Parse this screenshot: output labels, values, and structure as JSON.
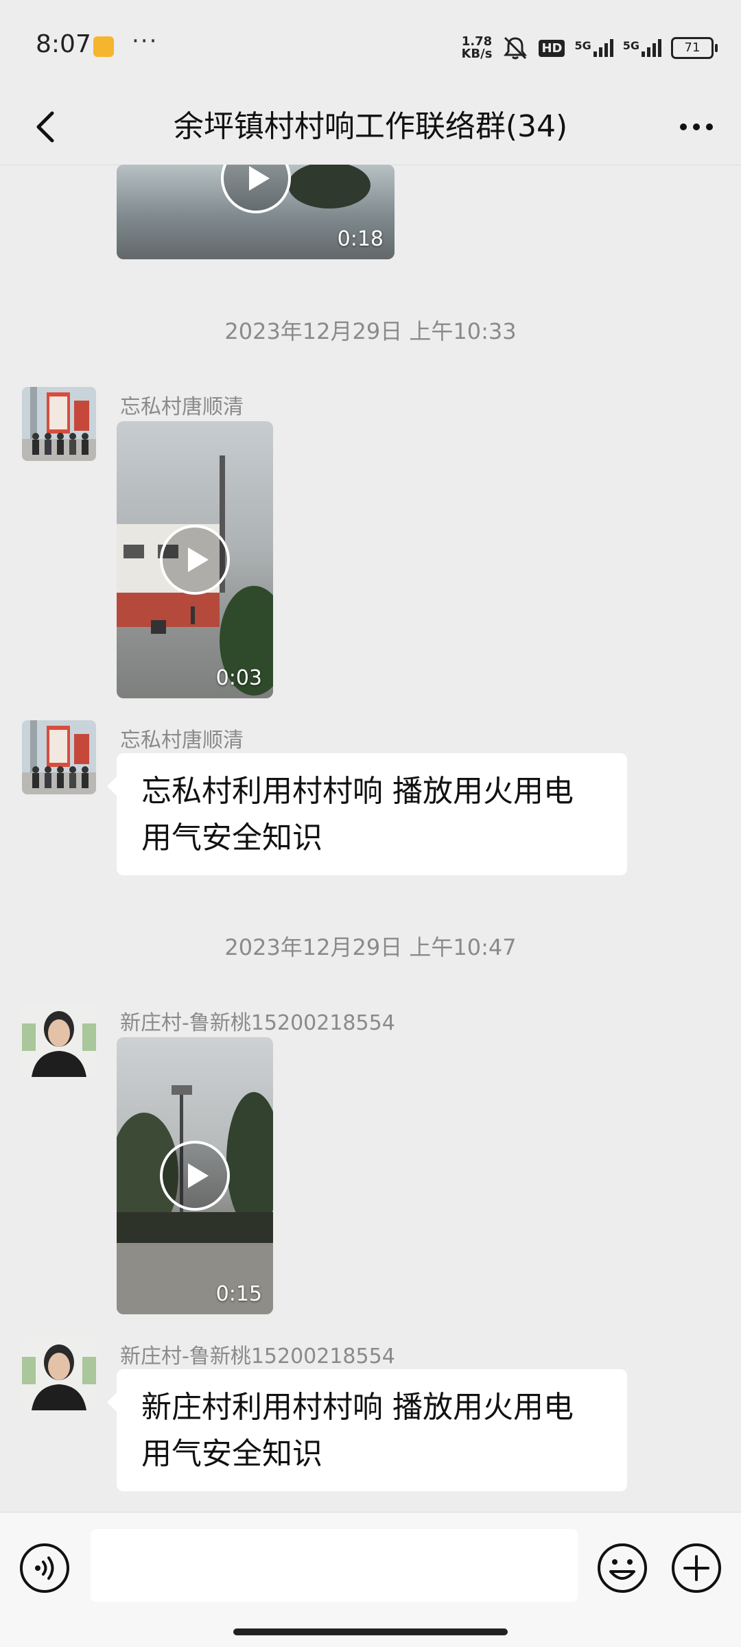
{
  "status_bar": {
    "time": "8:07",
    "dots": "···",
    "net_speed_value": "1.78",
    "net_speed_unit": "KB/s",
    "hd": "HD",
    "signal_1": "5G",
    "signal_2": "5G",
    "battery": "71"
  },
  "header": {
    "title": "余坪镇村村响工作联络群(34)"
  },
  "messages": [
    {
      "type": "video",
      "duration": "0:18"
    },
    {
      "type": "timestamp",
      "text": "2023年12月29日 上午10:33"
    },
    {
      "type": "video",
      "sender": "忘私村唐顺清",
      "duration": "0:03"
    },
    {
      "type": "text",
      "sender": "忘私村唐顺清",
      "text": "忘私村利用村村响 播放用火用电用气安全知识"
    },
    {
      "type": "timestamp",
      "text": "2023年12月29日 上午10:47"
    },
    {
      "type": "video",
      "sender": "新庄村-鲁新桃15200218554",
      "duration": "0:15"
    },
    {
      "type": "text",
      "sender": "新庄村-鲁新桃15200218554",
      "text": "新庄村利用村村响 播放用火用电用气安全知识"
    }
  ],
  "input_bar": {
    "placeholder": ""
  },
  "colors": {
    "background": "#ededed",
    "bubble": "#ffffff",
    "meta_text": "#8a8a8a"
  }
}
